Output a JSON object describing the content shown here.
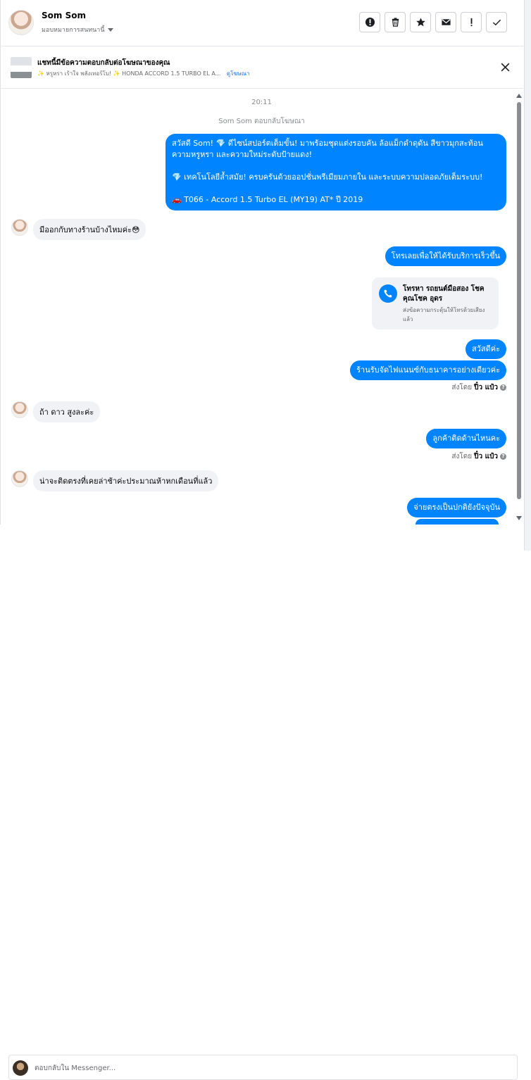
{
  "header": {
    "name": "Som Som",
    "assign_label": "มอบหมายการสนทนานี้",
    "actions": [
      "mark-icon",
      "delete-icon",
      "star-icon",
      "email-icon",
      "important-icon",
      "done-icon"
    ]
  },
  "banner": {
    "title": "แชทนี้มีข้อความตอบกลับต่อโฆษณาของคุณ",
    "desc": "✨ หรูหรา เร้าใจ พลังเทอร์โบ! ✨ HONDA ACCORD 1.5 TURBO EL A...",
    "link": "ดูโฆษณา"
  },
  "chat": {
    "time": "20:11",
    "reply_note": "Som Som ตอบกลับโฆษณา",
    "ad_message": {
      "line1": "สวัสดี Som! 💎 ดีไซน์สปอร์ตเต็มขั้น! มาพร้อมชุดแต่งรอบคัน ล้อแม็กดำดุดัน สีขาวมุกสะท้อนความหรูหรา และความใหม่ระดับป้ายแดง!",
      "line2": "💎 เทคโนโลยีล้ำสมัย! ครบครันด้วยออปชั่นพรีเมียมภายใน และระบบความปลอดภัยเต็มระบบ!",
      "line3": "🚗 T066 - Accord 1.5 Turbo EL (MY19) AT* ปี 2019"
    },
    "in1": "มีออกกับทางร้านบ้างไหมค่ะ😳",
    "out1": "โทรเลยเพื่อให้ได้รับบริการเร็วขึ้น",
    "call": {
      "title": "โทรหา รถยนต์มือสอง โชคคุณโชค อุดร",
      "sub": "ส่งข้อความกระตุ้นให้โทรด้วยเสียงแล้ว"
    },
    "out2": "สวัสดีค่ะ",
    "out3": "ร้านรับจัดไฟแนนซ์กับธนาคารอย่างเดียวค่ะ",
    "sent_by_label": "ส่งโดย",
    "sent_by_name": "ปิ๋ว แป๋ว",
    "in2": "ถ้า ดาว สูงละค่ะ",
    "out4": "ลูกค้าติดด้านไหนคะ",
    "in3": "น่าจะติดตรงที่เคยล่าช้าค่ะประมาณห้าหกเดือนที่แล้ว",
    "out5": "จ่ายตรงเป็นปกติยังปัจจุบัน"
  },
  "composer": {
    "placeholder": "ตอบกลับใน Messenger..."
  }
}
